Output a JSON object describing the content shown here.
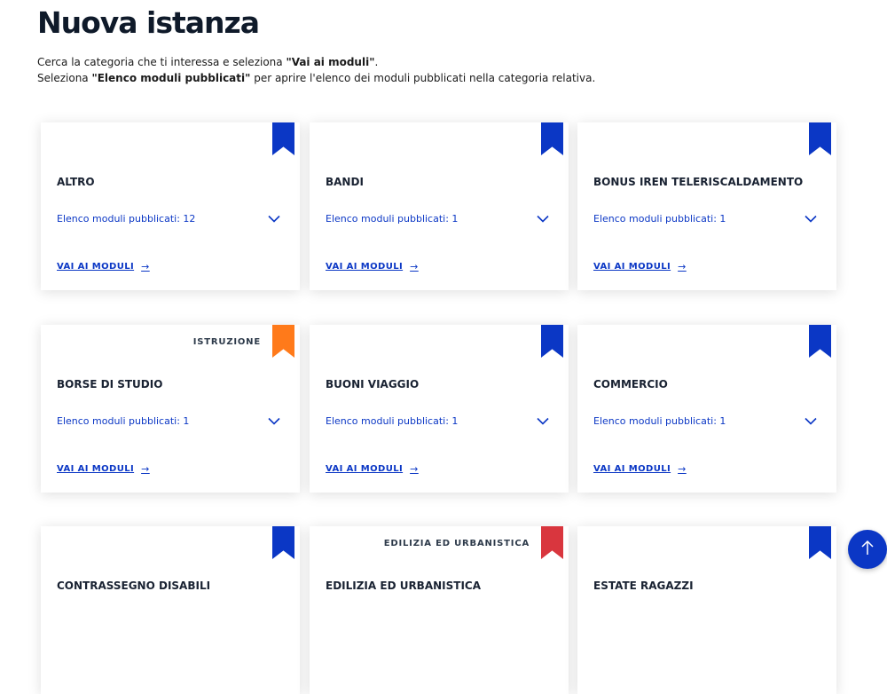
{
  "page": {
    "title": "Nuova istanza",
    "intro_line1_pre": "Cerca la categoria che ti interessa e seleziona ",
    "intro_line1_bold": "\"Vai ai moduli\"",
    "intro_line1_post": ".",
    "intro_line2_pre": "Seleziona ",
    "intro_line2_bold": "\"Elenco moduli pubblicati\"",
    "intro_line2_post": " per aprire l'elenco dei moduli pubblicati nella categoria relativa."
  },
  "colors": {
    "blue_ribbon": "#0b37c5",
    "orange_ribbon": "#ff7a1a",
    "red_ribbon": "#d9363e",
    "link": "#0b37c5"
  },
  "cards": [
    {
      "title": "ALTRO",
      "topic": "",
      "ribbon_color": "#0b37c5",
      "count_label": "Elenco moduli pubblicati: 12",
      "link_label": "VAI AI MODULI"
    },
    {
      "title": "BANDI",
      "topic": "",
      "ribbon_color": "#0b37c5",
      "count_label": "Elenco moduli pubblicati: 1",
      "link_label": "VAI AI MODULI"
    },
    {
      "title": "BONUS IREN TELERISCALDAMENTO",
      "topic": "",
      "ribbon_color": "#0b37c5",
      "count_label": "Elenco moduli pubblicati: 1",
      "link_label": "VAI AI MODULI"
    },
    {
      "title": "BORSE DI STUDIO",
      "topic": "ISTRUZIONE",
      "ribbon_color": "#ff7a1a",
      "count_label": "Elenco moduli pubblicati: 1",
      "link_label": "VAI AI MODULI"
    },
    {
      "title": "BUONI VIAGGIO",
      "topic": "",
      "ribbon_color": "#0b37c5",
      "count_label": "Elenco moduli pubblicati: 1",
      "link_label": "VAI AI MODULI"
    },
    {
      "title": "COMMERCIO",
      "topic": "",
      "ribbon_color": "#0b37c5",
      "count_label": "Elenco moduli pubblicati: 1",
      "link_label": "VAI AI MODULI"
    },
    {
      "title": "CONTRASSEGNO DISABILI",
      "topic": "",
      "ribbon_color": "#0b37c5",
      "count_label": "",
      "link_label": ""
    },
    {
      "title": "EDILIZIA ED URBANISTICA",
      "topic": "EDILIZIA ED URBANISTICA",
      "ribbon_color": "#d9363e",
      "count_label": "",
      "link_label": ""
    },
    {
      "title": "ESTATE RAGAZZI",
      "topic": "",
      "ribbon_color": "#0b37c5",
      "count_label": "",
      "link_label": ""
    }
  ],
  "icons": {
    "ribbon": "bookmark-ribbon-icon",
    "expand": "chevron-down-icon",
    "link_arrow": "arrow-right-icon",
    "back_to_top": "arrow-up-icon"
  }
}
